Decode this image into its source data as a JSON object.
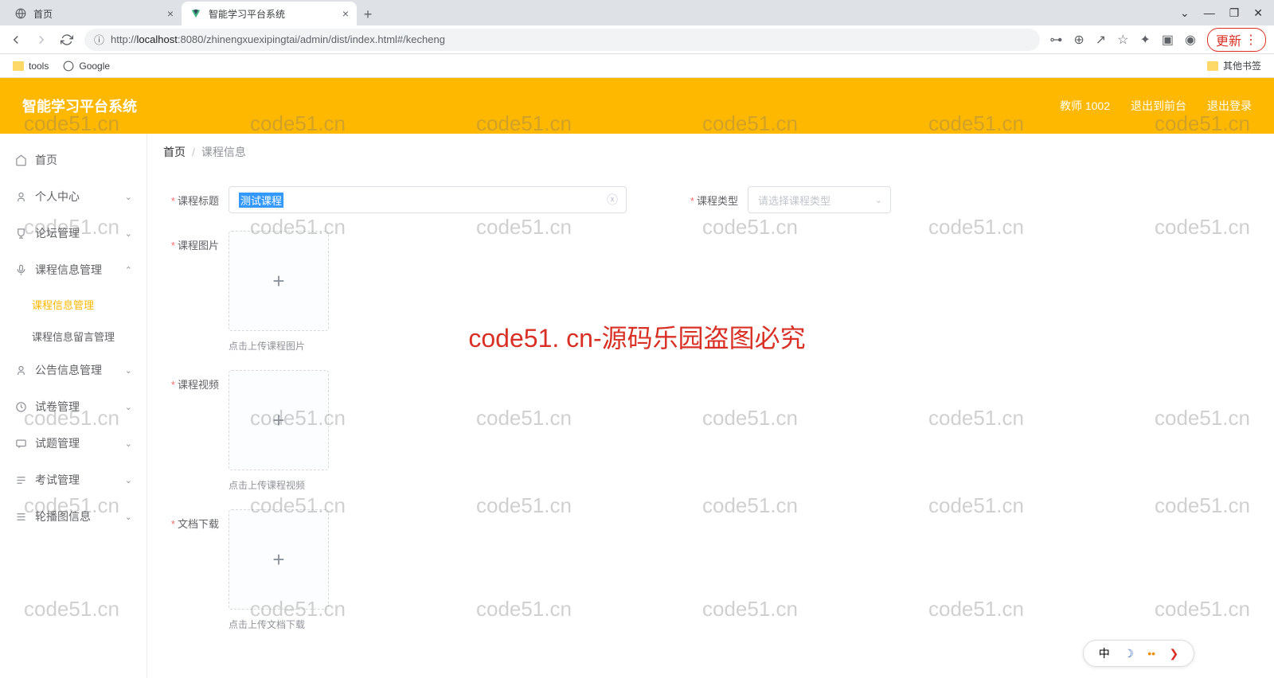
{
  "browser": {
    "tabs": [
      {
        "title": "首页"
      },
      {
        "title": "智能学习平台系统"
      }
    ],
    "url_prefix": "http://",
    "url_host": "localhost",
    "url_port": ":8080",
    "url_path": "/zhinengxuexipingtai/admin/dist/index.html#/kecheng",
    "update_label": "更新"
  },
  "bookmarks": {
    "tools": "tools",
    "google": "Google",
    "other": "其他书签"
  },
  "header": {
    "title": "智能学习平台系统",
    "user": "教师 1002",
    "exit_front": "退出到前台",
    "logout": "退出登录"
  },
  "sidebar": {
    "home": "首页",
    "personal": "个人中心",
    "forum": "论坛管理",
    "course_mgmt": "课程信息管理",
    "course_info": "课程信息管理",
    "course_comment": "课程信息留言管理",
    "notice": "公告信息管理",
    "exam_paper": "试卷管理",
    "question": "试题管理",
    "exam": "考试管理",
    "carousel": "轮播图信息"
  },
  "breadcrumb": {
    "home": "首页",
    "current": "课程信息"
  },
  "form": {
    "title_label": "课程标题",
    "title_value": "测试课程",
    "type_label": "课程类型",
    "type_placeholder": "请选择课程类型",
    "image_label": "课程图片",
    "image_hint": "点击上传课程图片",
    "video_label": "课程视频",
    "video_hint": "点击上传课程视频",
    "doc_label": "文档下载",
    "doc_hint": "点击上传文档下载"
  },
  "watermark": {
    "text": "code51.cn",
    "center": "code51. cn-源码乐园盗图必究"
  },
  "ime": {
    "lang": "中"
  }
}
